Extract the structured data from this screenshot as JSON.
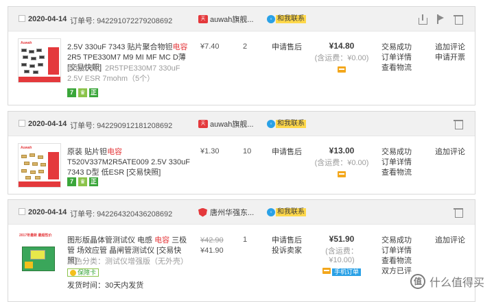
{
  "orders": [
    {
      "date": "2020-04-14",
      "order_no_label": "订单号:",
      "order_no": "942291072279208692",
      "shop_name": "auwah旗舰...",
      "shop_icon": "tmall-icon",
      "contact_label": "和我联系",
      "item": {
        "title_pre": "2.5V 330uF 7343 贴片聚合物钽",
        "title_red": "电容",
        "title_post": " 2R5 TPE330M7 M9 MI MF MC D薄 [交易快照]",
        "spec": "颜色分类：2R5TPE330M7 330uF 2.5V ESR 7mohm（5个）",
        "price": "¥7.40",
        "qty": "2",
        "status": "申请售后"
      },
      "total": "¥14.80",
      "shipping": "(含运费：¥0.00)",
      "ops": [
        "交易成功",
        "订单详情",
        "查看物流"
      ],
      "ops2": [
        "追加评论",
        "申请开票"
      ]
    },
    {
      "date": "2020-04-14",
      "order_no_label": "订单号:",
      "order_no": "942290912181208692",
      "shop_name": "auwah旗舰...",
      "shop_icon": "tmall-icon",
      "contact_label": "和我联系",
      "item": {
        "title_pre": "原装 贴片钽",
        "title_red": "电容",
        "title_post": " T520V337M2R5ATE009 2.5V 330uF 7343 D型 低ESR [交易快照]",
        "price": "¥1.30",
        "qty": "10",
        "status": "申请售后"
      },
      "total": "¥13.00",
      "shipping": "(含运费：¥0.00)",
      "ops": [
        "交易成功",
        "订单详情",
        "查看物流"
      ],
      "ops2": [
        "追加评论"
      ]
    },
    {
      "date": "2020-04-14",
      "order_no_label": "订单号:",
      "order_no": "942264320436208692",
      "shop_name": "唐州华强东...",
      "shop_icon": "shield-shop-icon",
      "contact_label": "和我联系",
      "item": {
        "title_pre": "图形版晶体管测试仪 电感 ",
        "title_red": "电容",
        "title_post": " 三极管 场效应管 晶闸管测试仪 [交易快照]",
        "spec": "颜色分类：测试仪增强版（无外壳）",
        "safe_label": "保障卡",
        "delivery": "发货时间：30天内发货",
        "price_old": "¥42.90",
        "price": "¥41.90",
        "qty": "1",
        "status": "申请售后",
        "status2": "投诉卖家",
        "thumb_text": "2017年最新 最超性价"
      },
      "total": "¥51.90",
      "shipping": "(含运费：¥10.00)",
      "mobile_label": "手机订单",
      "ops": [
        "交易成功",
        "订单详情",
        "查看物流",
        "双方已评"
      ],
      "ops2": [
        "追加评论"
      ]
    }
  ],
  "watermark": "什么值得买",
  "watermark_logo": "值"
}
